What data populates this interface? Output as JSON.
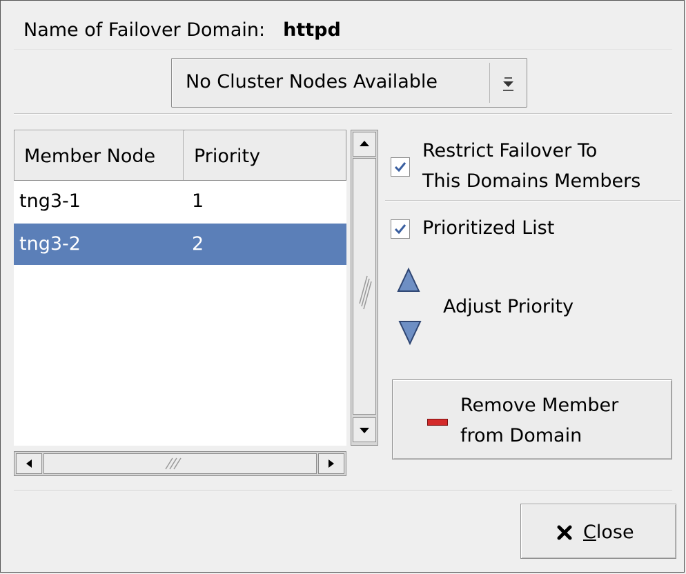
{
  "header": {
    "label": "Name of Failover Domain:",
    "value": "httpd"
  },
  "combo": {
    "selected": "No Cluster Nodes Available",
    "icon": "chevron-down-icon"
  },
  "list": {
    "columns": [
      "Member Node",
      "Priority"
    ],
    "rows": [
      {
        "node": "tng3-1",
        "priority": "1",
        "selected": false
      },
      {
        "node": "tng3-2",
        "priority": "2",
        "selected": true
      }
    ]
  },
  "options": {
    "restrict_line1": "Restrict Failover To",
    "restrict_line2": "This Domains Members",
    "restrict_checked": true,
    "prioritized": "Prioritized List",
    "prioritized_checked": true
  },
  "priority": {
    "label": "Adjust Priority"
  },
  "remove_button": {
    "line1": "Remove Member",
    "line2": "from Domain"
  },
  "close_button": {
    "mnemonic": "C",
    "rest": "lose"
  },
  "colors": {
    "selection": "#5b7fb8",
    "background": "#efefef",
    "arrow": "#6e8fc4",
    "remove_icon": "#d42a2a"
  }
}
